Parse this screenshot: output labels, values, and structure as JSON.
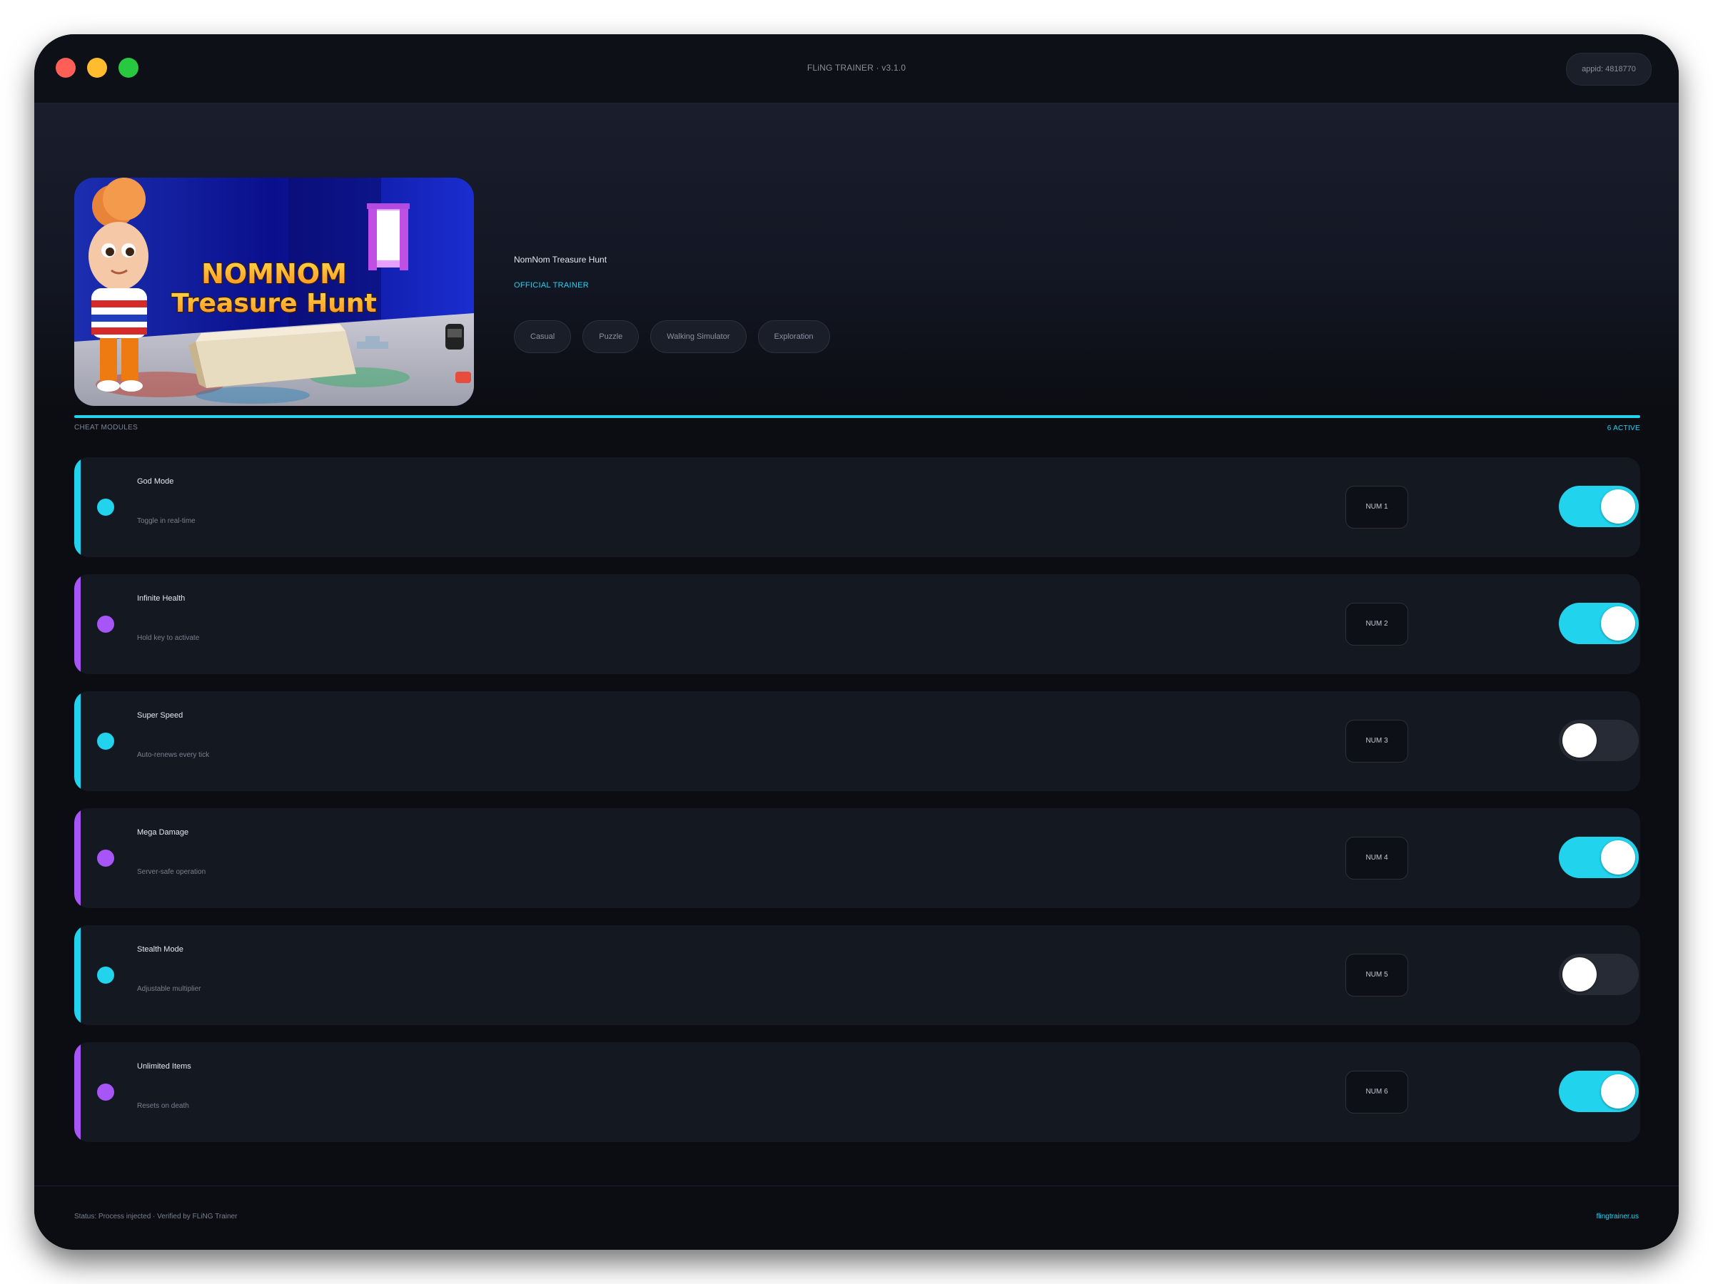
{
  "window": {
    "title": "FLiNG TRAINER · v3.1.0",
    "appid": "appid: 4818770"
  },
  "game": {
    "title": "NomNom Treasure Hunt",
    "badge": "OFFICIAL TRAINER",
    "cover_line1": "NOMNOM",
    "cover_line2": "Treasure Hunt",
    "tags": [
      "Casual",
      "Puzzle",
      "Walking Simulator",
      "Exploration"
    ]
  },
  "modules_section": {
    "label": "CHEAT MODULES",
    "active_count": "6 ACTIVE"
  },
  "modules": [
    {
      "name": "God Mode",
      "desc": "Toggle in real-time",
      "hotkey": "NUM 1",
      "enabled": true,
      "accent": "#22d3ee"
    },
    {
      "name": "Infinite Health",
      "desc": "Hold key to activate",
      "hotkey": "NUM 2",
      "enabled": true,
      "accent": "#a855f7"
    },
    {
      "name": "Super Speed",
      "desc": "Auto-renews every tick",
      "hotkey": "NUM 3",
      "enabled": false,
      "accent": "#22d3ee"
    },
    {
      "name": "Mega Damage",
      "desc": "Server-safe operation",
      "hotkey": "NUM 4",
      "enabled": true,
      "accent": "#a855f7"
    },
    {
      "name": "Stealth Mode",
      "desc": "Adjustable multiplier",
      "hotkey": "NUM 5",
      "enabled": false,
      "accent": "#22d3ee"
    },
    {
      "name": "Unlimited Items",
      "desc": "Resets on death",
      "hotkey": "NUM 6",
      "enabled": true,
      "accent": "#a855f7"
    }
  ],
  "footer": {
    "status": "Status: Process injected · Verified by FLiNG Trainer",
    "link": "flingtrainer.us"
  },
  "colors": {
    "accent": "#22d3ee",
    "accent_alt": "#a855f7",
    "toggle_off": "#272b35",
    "background": "#0b0d12"
  }
}
